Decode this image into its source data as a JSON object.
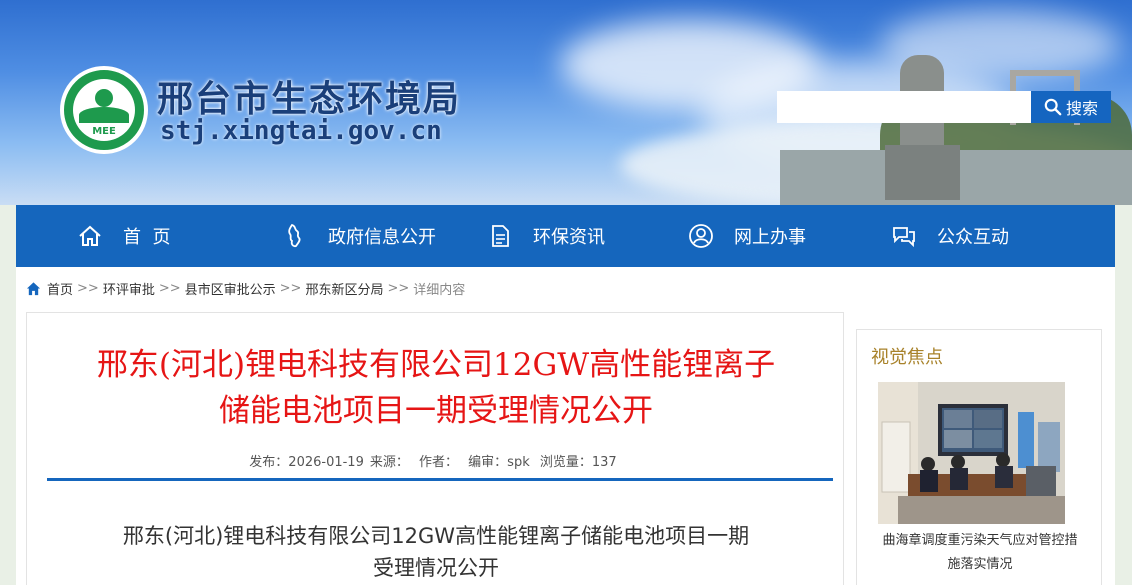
{
  "header": {
    "site_title": "邢台市生态环境局",
    "site_url": "stj.xingtai.gov.cn",
    "logo_text": "MEE",
    "search": {
      "placeholder": "",
      "button_label": "搜索"
    }
  },
  "nav": {
    "items": [
      {
        "label": "首  页",
        "icon": "home-icon"
      },
      {
        "label": "政府信息公开",
        "icon": "hebei-map-icon"
      },
      {
        "label": "环保资讯",
        "icon": "document-icon"
      },
      {
        "label": "网上办事",
        "icon": "user-circle-icon"
      },
      {
        "label": "公众互动",
        "icon": "chat-bubbles-icon"
      }
    ]
  },
  "breadcrumb": {
    "items": [
      "首页",
      "环评审批",
      "县市区审批公示",
      "邢东新区分局"
    ],
    "separator": ">>",
    "current": "详细内容"
  },
  "article": {
    "title_line1": "邢东(河北)锂电科技有限公司12GW高性能锂离子",
    "title_line2": "储能电池项目一期受理情况公开",
    "meta": {
      "publish": "发布：2026-01-19",
      "source": "来源：",
      "author": "作者：",
      "editor": "编审：spk",
      "views": "浏览量：137"
    },
    "body_title_line1": "邢东(河北)锂电科技有限公司12GW高性能锂离子储能电池项目一期",
    "body_title_line2": "受理情况公开"
  },
  "sidebar": {
    "heading": "视觉焦点",
    "caption_line1": "曲海章调度重污染天气应对管控措",
    "caption_line2": "施落实情况"
  },
  "colors": {
    "nav_blue": "#1566bd",
    "title_red": "#e61515",
    "logo_green": "#1e9a4d",
    "sidebar_heading": "#a8822a"
  }
}
